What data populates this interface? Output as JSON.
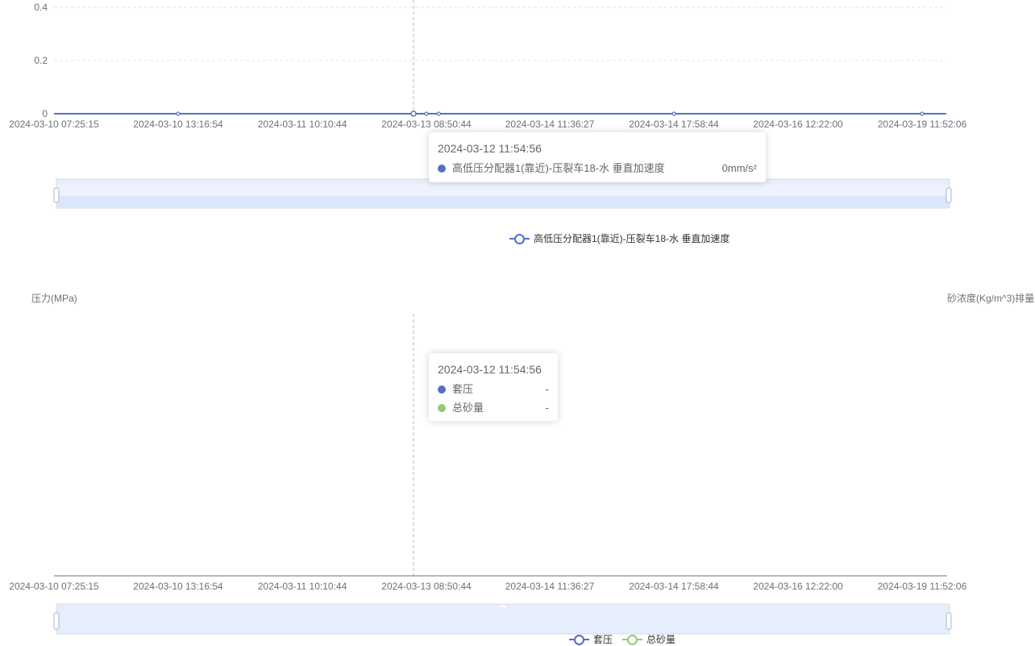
{
  "colors": {
    "series_blue": "#5470c6",
    "series_green": "#91cc75",
    "axis": "#6e7079",
    "grid": "#e0e6f1",
    "zoom_fill": "#dbe5fb"
  },
  "chart_data": [
    {
      "type": "line",
      "x_tick_labels": [
        "2024-03-10 07:25:15",
        "2024-03-10 13:16:54",
        "2024-03-11 10:10:44",
        "2024-03-13 08:50:44",
        "2024-03-14 11:36:27",
        "2024-03-14 17:58:44",
        "2024-03-16 12:22:00",
        "2024-03-19 11:52:06"
      ],
      "y_tick_labels": [
        "0",
        "0.2",
        "0.4"
      ],
      "ylim": [
        0,
        0.4
      ],
      "grid": true,
      "series": [
        {
          "name": "高低压分配器1(靠近)-压裂车18-水 垂直加速度",
          "color": "#5470c6",
          "values": [
            0,
            0,
            0,
            0,
            0,
            0,
            0,
            0
          ],
          "symbol_positions": [
            1,
            3,
            3.1,
            5,
            7
          ]
        }
      ],
      "legend": {
        "position": "bottom-center",
        "items": [
          "高低压分配器1(靠近)-压裂车18-水 垂直加速度"
        ]
      },
      "tooltip": {
        "title": "2024-03-12 11:54:56",
        "rows": [
          {
            "name": "高低压分配器1(靠近)-压裂车18-水 垂直加速度",
            "value": "0mm/s²",
            "color": "#5470c6"
          }
        ]
      }
    },
    {
      "type": "line",
      "ylabel_left": "压力(MPa)",
      "ylabel_right": "砂浓度(Kg/m^3)排量",
      "x_tick_labels": [
        "2024-03-10 07:25:15",
        "2024-03-10 13:16:54",
        "2024-03-11 10:10:44",
        "2024-03-13 08:50:44",
        "2024-03-14 11:36:27",
        "2024-03-14 17:58:44",
        "2024-03-16 12:22:00",
        "2024-03-19 11:52:06"
      ],
      "series": [
        {
          "name": "套压",
          "color": "#5470c6",
          "values": []
        },
        {
          "name": "总砂量",
          "color": "#91cc75",
          "values": []
        }
      ],
      "legend": {
        "position": "bottom-center",
        "items": [
          "套压",
          "总砂量"
        ]
      },
      "tooltip": {
        "title": "2024-03-12 11:54:56",
        "rows": [
          {
            "name": "套压",
            "value": "-",
            "color": "#5470c6"
          },
          {
            "name": "总砂量",
            "value": "-",
            "color": "#91cc75"
          }
        ]
      }
    }
  ]
}
